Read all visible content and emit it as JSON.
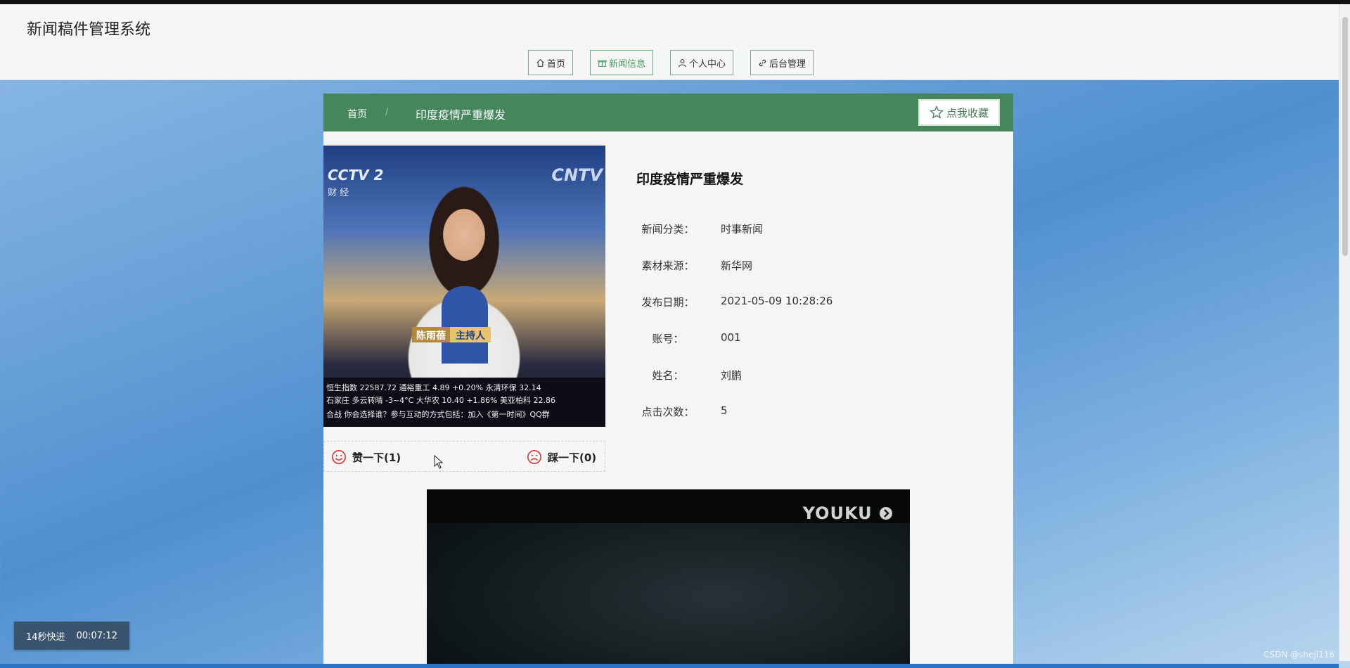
{
  "site": {
    "title": "新闻稿件管理系统"
  },
  "nav": {
    "items": [
      {
        "label": "首页",
        "icon": "home-icon",
        "active": false
      },
      {
        "label": "新闻信息",
        "icon": "gift-icon",
        "active": true
      },
      {
        "label": "个人中心",
        "icon": "user-icon",
        "active": false
      },
      {
        "label": "后台管理",
        "icon": "link-icon",
        "active": false
      }
    ]
  },
  "breadcrumb": {
    "home": "首页",
    "separator": "/",
    "current": "印度疫情严重爆发"
  },
  "favorite": {
    "label": "点我收藏",
    "icon": "star-icon"
  },
  "cover": {
    "channel_logo": "CCTV 2",
    "channel_sub": "财 经",
    "logo_right": "CNTV",
    "name_tag": "陈雨蓓",
    "role_tag": "主持人",
    "ticker_line1": "恒生指数   22587.72   通裕重工 4.89 +0.20% 永清环保 32.14",
    "ticker_line2": "石家庄 多云转晴 -3~4°C   大华农 10.40 +1.86% 美亚柏科 22.86",
    "ticker_line3": "合战 你会选择谁？参与互动的方式包括：加入《第一时间》QQ群"
  },
  "votes": {
    "like_label": "赞一下(1)",
    "dislike_label": "踩一下(0)"
  },
  "news": {
    "title": "印度疫情严重爆发",
    "fields": [
      {
        "label": "新闻分类：",
        "value": "时事新闻"
      },
      {
        "label": "素材来源：",
        "value": "新华网"
      },
      {
        "label": "发布日期：",
        "value": "2021-05-09 10:28:26"
      },
      {
        "label": "账号：",
        "value": "001"
      },
      {
        "label": "姓名：",
        "value": "刘鹏"
      },
      {
        "label": "点击次数：",
        "value": "5"
      }
    ]
  },
  "video": {
    "brand": "YOUKU"
  },
  "playback": {
    "speed_label": "14秒快进",
    "time": "00:07:12"
  },
  "watermark": "CSDN @sheji116",
  "colors": {
    "primary_green": "#45875a",
    "active_nav": "#4a9a64",
    "vote_icon": "#d83b3b"
  }
}
